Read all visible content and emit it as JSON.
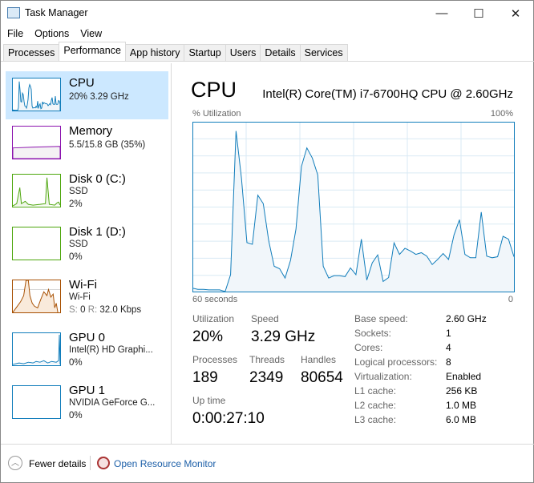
{
  "window": {
    "title": "Task Manager",
    "minimize": "—",
    "maximize": "☐",
    "close": "✕"
  },
  "menu": [
    "File",
    "Options",
    "View"
  ],
  "tabs": [
    "Processes",
    "Performance",
    "App history",
    "Startup",
    "Users",
    "Details",
    "Services"
  ],
  "sidebar": [
    {
      "name": "CPU",
      "line1": "20% 3.29 GHz",
      "color": "#117dbb"
    },
    {
      "name": "Memory",
      "line1": "5.5/15.8 GB (35%)",
      "color": "#8b12ae"
    },
    {
      "name": "Disk 0 (C:)",
      "line1": "SSD",
      "line2": "2%",
      "color": "#4da60c"
    },
    {
      "name": "Disk 1 (D:)",
      "line1": "SSD",
      "line2": "0%",
      "color": "#4da60c"
    },
    {
      "name": "Wi-Fi",
      "line1": "Wi-Fi",
      "s_label": "S:",
      "s_val": "0",
      "r_label": "R:",
      "r_val": "32.0 Kbps",
      "color": "#a74f01"
    },
    {
      "name": "GPU 0",
      "line1": "Intel(R) HD Graphi...",
      "line2": "0%",
      "color": "#117dbb"
    },
    {
      "name": "GPU 1",
      "line1": "NVIDIA GeForce G...",
      "line2": "0%",
      "color": "#117dbb"
    }
  ],
  "main": {
    "title": "CPU",
    "model": "Intel(R) Core(TM) i7-6700HQ CPU @ 2.60GHz"
  },
  "chart_data": {
    "type": "area",
    "ylabel": "% Utilization",
    "ymax_label": "100%",
    "xlabel_left": "60 seconds",
    "xlabel_right": "0",
    "ylim": [
      0,
      100
    ],
    "xlim": [
      60,
      0
    ],
    "grid": true,
    "color": "#117dbb",
    "values": [
      2,
      1.3,
      1.3,
      1,
      1,
      1,
      0,
      10,
      95,
      67,
      29,
      28,
      57,
      52,
      30,
      15,
      13.5,
      8,
      18.5,
      37,
      74,
      85,
      79,
      69,
      15,
      8,
      9.4,
      9.4,
      8.8,
      14,
      10,
      31,
      6.8,
      17,
      21.7,
      6,
      8.3,
      28.8,
      22,
      25.6,
      24,
      22,
      23,
      21,
      16,
      19,
      22.5,
      19,
      33.5,
      42.5,
      22,
      20,
      20,
      47,
      21,
      20,
      20.6,
      32.7,
      31,
      20.6
    ]
  },
  "stats": {
    "utilization_label": "Utilization",
    "utilization": "20%",
    "speed_label": "Speed",
    "speed": "3.29 GHz",
    "processes_label": "Processes",
    "processes": "189",
    "threads_label": "Threads",
    "threads": "2349",
    "handles_label": "Handles",
    "handles": "80654",
    "uptime_label": "Up time",
    "uptime": "0:00:27:10"
  },
  "specs": [
    [
      "Base speed:",
      "2.60 GHz"
    ],
    [
      "Sockets:",
      "1"
    ],
    [
      "Cores:",
      "4"
    ],
    [
      "Logical processors:",
      "8"
    ],
    [
      "Virtualization:",
      "Enabled"
    ],
    [
      "L1 cache:",
      "256 KB"
    ],
    [
      "L2 cache:",
      "1.0 MB"
    ],
    [
      "L3 cache:",
      "6.0 MB"
    ]
  ],
  "footer": {
    "fewer": "Fewer details",
    "monitor": "Open Resource Monitor"
  }
}
